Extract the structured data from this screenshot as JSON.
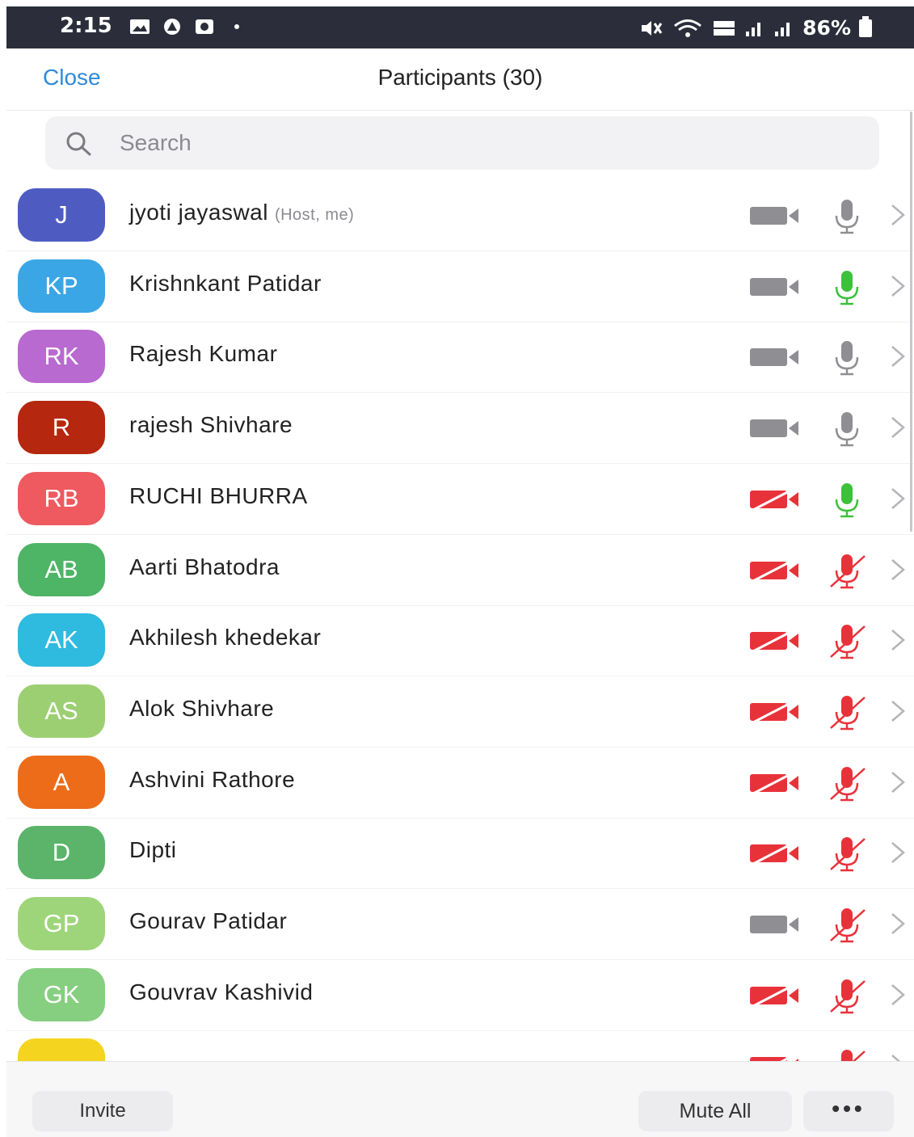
{
  "status_bar": {
    "time": "2:15",
    "battery": "86%",
    "left_icons": [
      "gallery-icon",
      "triangle-app-icon",
      "camera-app-icon",
      "dot-icon"
    ],
    "right_icons": [
      "mute-vibrate-icon",
      "wifi-icon",
      "volte-icon",
      "signal-icon",
      "signal-icon",
      "battery-icon"
    ]
  },
  "header": {
    "close_label": "Close",
    "title": "Participants (30)"
  },
  "search": {
    "placeholder": "Search"
  },
  "participants": [
    {
      "initials": "J",
      "name": "jyoti jayaswal",
      "tag": "(Host, me)",
      "color": "#4e5cc2",
      "video": "on",
      "mic": "grey"
    },
    {
      "initials": "KP",
      "name": "Krishnkant Patidar",
      "tag": "",
      "color": "#3aa6e6",
      "video": "on",
      "mic": "green"
    },
    {
      "initials": "RK",
      "name": "Rajesh Kumar",
      "tag": "",
      "color": "#b86ad0",
      "video": "on",
      "mic": "grey"
    },
    {
      "initials": "R",
      "name": "rajesh Shivhare",
      "tag": "",
      "color": "#b5270e",
      "video": "on",
      "mic": "grey"
    },
    {
      "initials": "RB",
      "name": "RUCHI BHURRA",
      "tag": "",
      "color": "#ee5a5f",
      "video": "off",
      "mic": "green"
    },
    {
      "initials": "AB",
      "name": "Aarti Bhatodra",
      "tag": "",
      "color": "#4eb466",
      "video": "off",
      "mic": "muted"
    },
    {
      "initials": "AK",
      "name": "Akhilesh khedekar",
      "tag": "",
      "color": "#2fbadf",
      "video": "off",
      "mic": "muted"
    },
    {
      "initials": "AS",
      "name": "Alok Shivhare",
      "tag": "",
      "color": "#9ccf72",
      "video": "off",
      "mic": "muted"
    },
    {
      "initials": "A",
      "name": "Ashvini Rathore",
      "tag": "",
      "color": "#ec6c1a",
      "video": "off",
      "mic": "muted"
    },
    {
      "initials": "D",
      "name": "Dipti",
      "tag": "",
      "color": "#5bb46a",
      "video": "off",
      "mic": "muted"
    },
    {
      "initials": "GP",
      "name": "Gourav Patidar",
      "tag": "",
      "color": "#9fd57a",
      "video": "on",
      "mic": "muted"
    },
    {
      "initials": "GK",
      "name": "Gouvrav Kashivid",
      "tag": "",
      "color": "#86cf80",
      "video": "off",
      "mic": "muted"
    },
    {
      "initials": "",
      "name": "",
      "tag": "",
      "color": "#f5d41f",
      "video": "off",
      "mic": "muted"
    }
  ],
  "footer": {
    "invite_label": "Invite",
    "mute_all_label": "Mute All",
    "more_label": "•••"
  },
  "colors": {
    "accent": "#2e8bd9",
    "status_bar": "#2b2e3a",
    "muted_red": "#e8323a",
    "talking_green": "#3cc13b",
    "icon_grey": "#8e8e93"
  }
}
